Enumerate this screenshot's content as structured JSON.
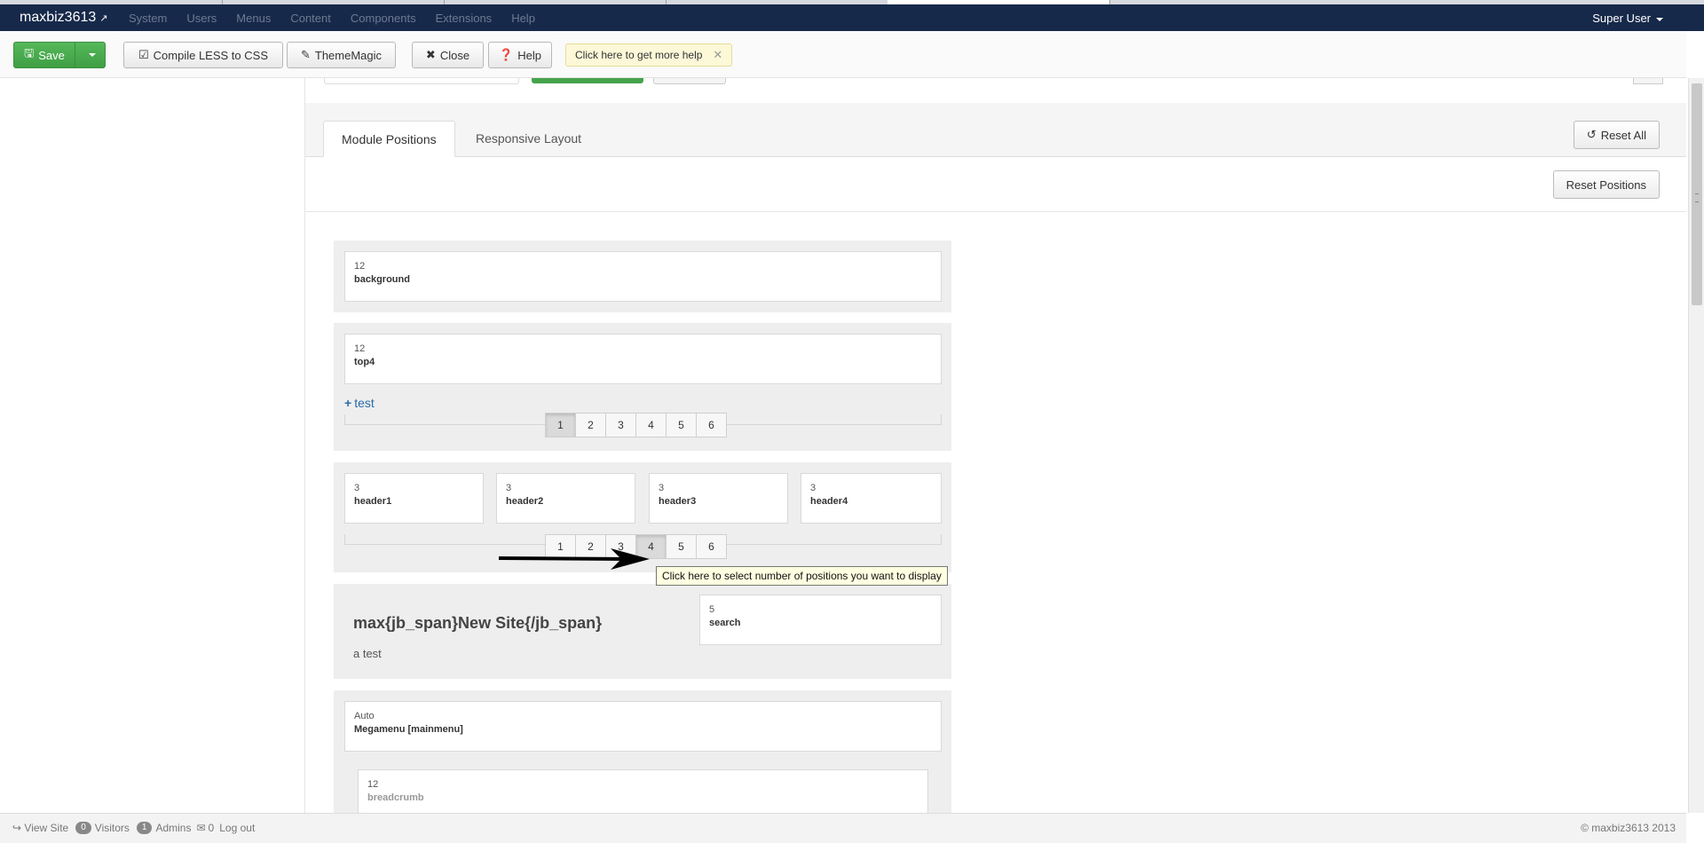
{
  "navbar": {
    "brand": "maxbiz3613",
    "menu": [
      "System",
      "Users",
      "Menus",
      "Content",
      "Components",
      "Extensions",
      "Help"
    ],
    "user": "Super User"
  },
  "toolbar": {
    "save": "Save",
    "compile": "Compile LESS to CSS",
    "thememagic": "ThemeMagic",
    "close": "Close",
    "help": "Help",
    "help_tip": "Click here to get more help"
  },
  "tabs": {
    "module_positions": "Module Positions",
    "responsive_layout": "Responsive Layout"
  },
  "actions": {
    "reset_all": "Reset All",
    "reset_positions": "Reset Positions"
  },
  "rows": {
    "background": {
      "width": "12",
      "name": "background"
    },
    "top4": {
      "width": "12",
      "name": "top4",
      "add_label": "test",
      "pager": [
        "1",
        "2",
        "3",
        "4",
        "5",
        "6"
      ],
      "selected": "1"
    },
    "headers": {
      "items": [
        {
          "width": "3",
          "name": "header1"
        },
        {
          "width": "3",
          "name": "header2"
        },
        {
          "width": "3",
          "name": "header3"
        },
        {
          "width": "3",
          "name": "header4"
        }
      ],
      "pager": [
        "1",
        "2",
        "3",
        "4",
        "5",
        "6"
      ],
      "selected": "4"
    },
    "logo": {
      "title": "max{jb_span}New Site{/jb_span}",
      "subtitle": "a test",
      "search_width": "5",
      "search_name": "search"
    },
    "menu": {
      "width": "Auto",
      "name": "Megamenu [mainmenu]"
    },
    "breadcrumb": {
      "width": "12",
      "name": "breadcrumb"
    }
  },
  "tooltip": "Click here to select number of positions you want to display",
  "footer": {
    "view_site": "View Site",
    "visitors_count": "0",
    "visitors": "Visitors",
    "admins_count": "1",
    "admins": "Admins",
    "messages": "0",
    "logout": "Log out",
    "copyright": "© maxbiz3613 2013"
  },
  "colors": {
    "navbar": "#17294a",
    "save_green": "#46a34b",
    "link_blue": "#2a6ca8"
  }
}
